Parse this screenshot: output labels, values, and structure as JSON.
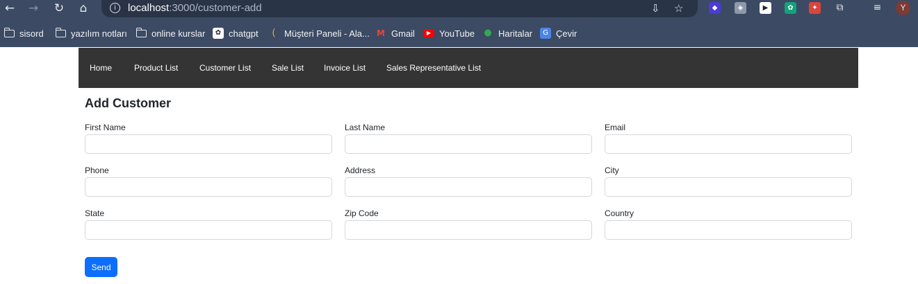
{
  "browser": {
    "url_host": "localhost",
    "url_rest": ":3000/customer-add",
    "profile_initial": "Y",
    "bookmarks": [
      {
        "label": "sisord",
        "icon": "folder-icon"
      },
      {
        "label": "yazılım notları",
        "icon": "folder-icon"
      },
      {
        "label": "online kurslar",
        "icon": "folder-icon"
      },
      {
        "label": "chatgpt",
        "icon": "chatgpt-icon"
      },
      {
        "label": "Müşteri Paneli - Ala...",
        "icon": "customer-panel-icon"
      },
      {
        "label": "Gmail",
        "icon": "gmail-icon"
      },
      {
        "label": "YouTube",
        "icon": "youtube-icon"
      },
      {
        "label": "Haritalar",
        "icon": "maps-icon"
      },
      {
        "label": "Çevir",
        "icon": "translate-icon"
      }
    ]
  },
  "navbar": {
    "links": [
      "Home",
      "Product List",
      "Customer List",
      "Sale List",
      "Invoice List",
      "Sales Representative List"
    ]
  },
  "form": {
    "title": "Add Customer",
    "fields": [
      {
        "label": "First Name",
        "value": ""
      },
      {
        "label": "Last Name",
        "value": ""
      },
      {
        "label": "Email",
        "value": ""
      },
      {
        "label": "Phone",
        "value": ""
      },
      {
        "label": "Address",
        "value": ""
      },
      {
        "label": "City",
        "value": ""
      },
      {
        "label": "State",
        "value": ""
      },
      {
        "label": "Zip Code",
        "value": ""
      },
      {
        "label": "Country",
        "value": ""
      }
    ],
    "submit_label": "Send"
  },
  "colors": {
    "chrome_bg": "#3c4a63",
    "navbar_bg": "#343434",
    "primary": "#0d6efd"
  }
}
